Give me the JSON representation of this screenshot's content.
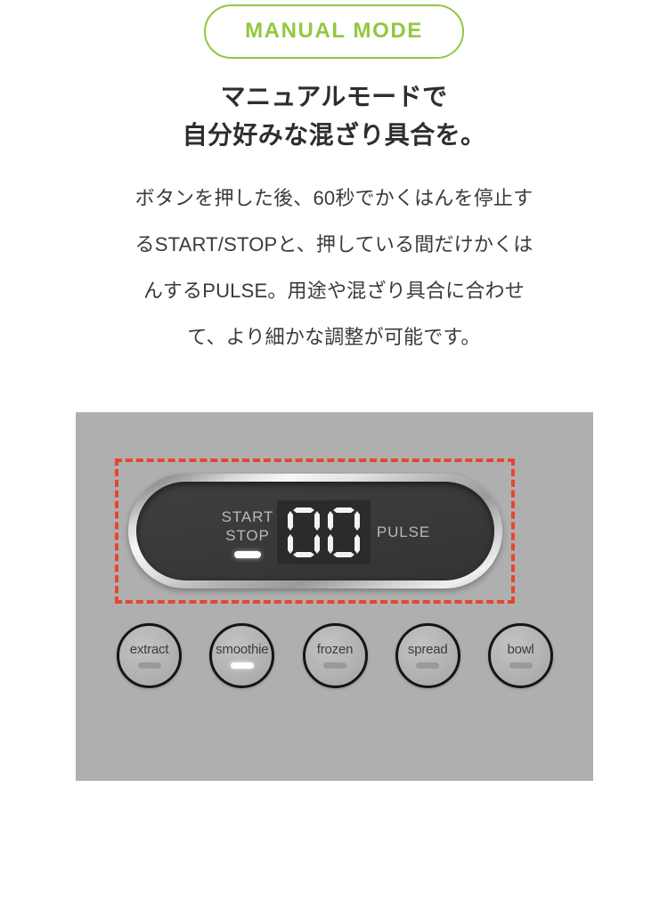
{
  "badge": {
    "label": "MANUAL MODE",
    "border_color": "#92c83d",
    "text_color": "#92c83d"
  },
  "heading": {
    "line1": "マニュアルモードで",
    "line2": "自分好みな混ざり具合を。"
  },
  "body": {
    "line1": "ボタンを押した後、60秒でかくはんを停止す",
    "line2": "るSTART/STOPと、押している間だけかくは",
    "line3": "んするPULSE。用途や混ざり具合に合わせ",
    "line4": "て、より細かな調整が可能です。"
  },
  "panel": {
    "background_color": "#afafaf",
    "highlight_color": "#e8452f",
    "control": {
      "start_stop": {
        "line1": "START",
        "line2": "STOP",
        "indicator_on": true
      },
      "pulse_label": "PULSE",
      "display": {
        "value": "00",
        "digit1": "0",
        "digit2": "0",
        "background_color": "#2b2b2b",
        "segment_color": "#f2f2f2"
      }
    },
    "modes": [
      {
        "label": "extract",
        "active": false
      },
      {
        "label": "smoothie",
        "active": true
      },
      {
        "label": "frozen",
        "active": false
      },
      {
        "label": "spread",
        "active": false
      },
      {
        "label": "bowl",
        "active": false
      }
    ]
  }
}
